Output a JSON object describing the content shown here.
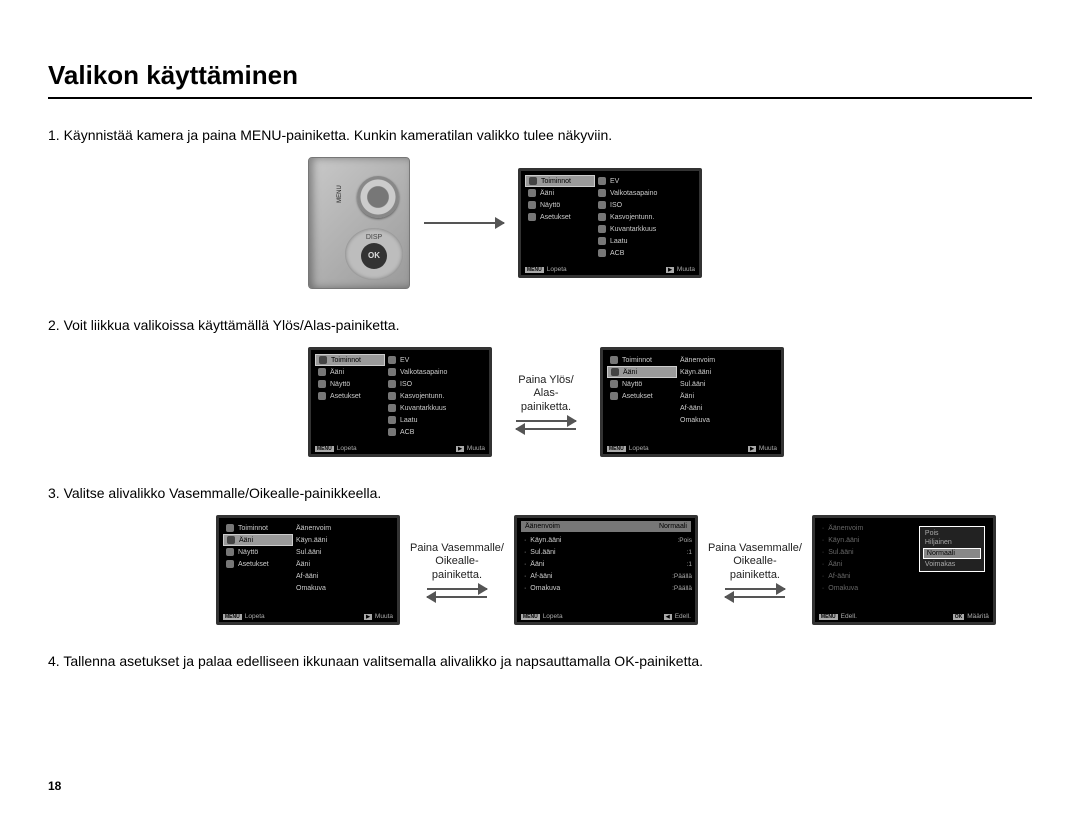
{
  "page_title": "Valikon käyttäminen",
  "page_number": "18",
  "steps": {
    "s1": "1. Käynnistää kamera ja paina MENU-painiketta.  Kunkin kameratilan valikko tulee näkyviin.",
    "s2": "2. Voit liikkua valikoissa käyttämällä Ylös/Alas-painiketta.",
    "s3": "3. Valitse alivalikko Vasemmalle/Oikealle-painikkeella.",
    "s4": "4. Tallenna asetukset ja palaa edelliseen ikkunaan valitsemalla alivalikko ja napsauttamalla OK-painiketta."
  },
  "camera_labels": {
    "menu": "MENU",
    "disp": "DISP",
    "ok": "OK"
  },
  "between_labels": {
    "updown": "Paina Ylös/\nAlas-\npainiketta.",
    "leftright": "Paina Vasemmalle/\nOikealle-\npainiketta."
  },
  "tabs": {
    "toiminnot": "Toiminnot",
    "aani": "Ääni",
    "naytto": "Näyttö",
    "asetukset": "Asetukset"
  },
  "func_items": {
    "ev": "EV",
    "valko": "Valkotasapaino",
    "iso": "ISO",
    "kasvo": "Kasvojentunn.",
    "kuvan": "Kuvantarkkuus",
    "laatu": "Laatu",
    "acb": "ACB"
  },
  "sound_items": {
    "aanenvoim": "Äänenvoim",
    "kaynaani": "Käyn.ääni",
    "sulaani": "Sul.ääni",
    "aani": "Ääni",
    "afaani": "Af-ääni",
    "omakuva": "Omakuva"
  },
  "sound_values": {
    "aanenvoim": "Normaali",
    "kaynaani": "Pois",
    "sulaani": "1",
    "aani": "1",
    "afaani": "Päällä",
    "omakuva": "Päällä"
  },
  "popup_options": {
    "pois": "Pois",
    "hiljainen": "Hiljainen",
    "normaali": "Normaali",
    "voimakas": "Voimakas"
  },
  "footer": {
    "lopeta": "Lopeta",
    "muuta": "Muuta",
    "edell": "Edell.",
    "maarita": "Määritä",
    "menu": "MENU",
    "ok": "OK",
    "play": "▶",
    "back": "◀"
  }
}
